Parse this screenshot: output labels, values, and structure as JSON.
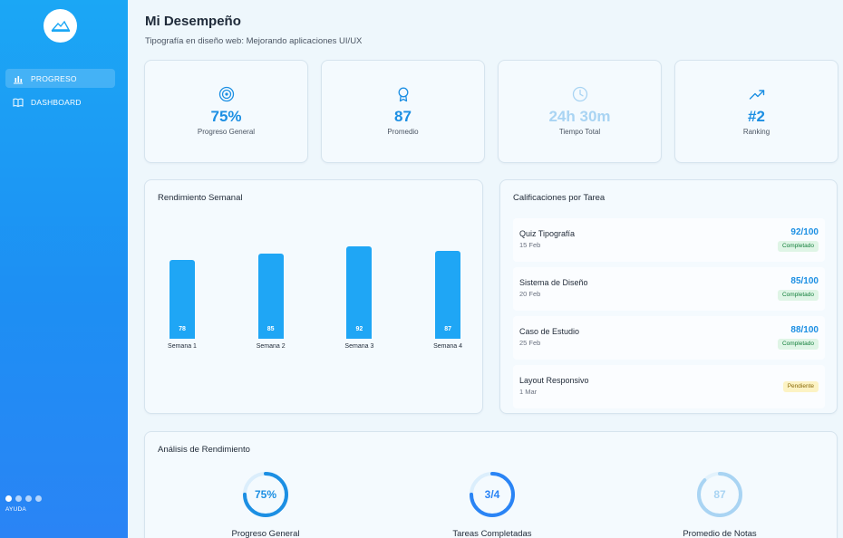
{
  "header": {
    "title": "Mi Desempeño",
    "subtitle": "Tipografía en diseño web: Mejorando aplicaciones UI/UX"
  },
  "sidebar": {
    "items": [
      {
        "label": "PROGRESO",
        "icon": "bar-chart-icon",
        "active": true
      },
      {
        "label": "DASHBOARD",
        "icon": "book-icon",
        "active": false
      }
    ],
    "help_label": "AYUDA"
  },
  "stats": [
    {
      "icon": "target-icon",
      "value": "75%",
      "label": "Progreso General"
    },
    {
      "icon": "award-icon",
      "value": "87",
      "label": "Promedio"
    },
    {
      "icon": "clock-icon",
      "value": "24h 30m",
      "label": "Tiempo Total"
    },
    {
      "icon": "trending-up-icon",
      "value": "#2",
      "label": "Ranking"
    }
  ],
  "weekly": {
    "title": "Rendimiento Semanal"
  },
  "chart_data": {
    "type": "bar",
    "categories": [
      "Semana 1",
      "Semana 2",
      "Semana 3",
      "Semana 4"
    ],
    "values": [
      78,
      85,
      92,
      87
    ]
  },
  "grades": {
    "title": "Calificaciones por Tarea",
    "items": [
      {
        "name": "Quiz Tipografía",
        "date": "15 Feb",
        "score": "92/100",
        "status": "Completado"
      },
      {
        "name": "Sistema de Diseño",
        "date": "20 Feb",
        "score": "85/100",
        "status": "Completado"
      },
      {
        "name": "Caso de Estudio",
        "date": "25 Feb",
        "score": "88/100",
        "status": "Completado"
      },
      {
        "name": "Layout Responsivo",
        "date": "1 Mar",
        "score": "",
        "status": "Pendiente"
      }
    ]
  },
  "analysis": {
    "title": "Análisis de Rendimiento",
    "rings": [
      {
        "value": "75%",
        "label": "Progreso General",
        "fraction": 0.75,
        "color": "#1c8fe3"
      },
      {
        "value": "3/4",
        "label": "Tareas Completadas",
        "fraction": 0.75,
        "color": "#2a84f5"
      },
      {
        "value": "87",
        "label": "Promedio de Notas",
        "fraction": 0.87,
        "color": "#a9d4f3"
      }
    ]
  },
  "colors": {
    "accent": "#1c8fe3",
    "bar": "#1fa6f5",
    "sidebar_top": "#1ba7f5",
    "sidebar_bottom": "#2a84f5",
    "completed_badge": "#dff5e6",
    "pending_badge": "#fcf3c4"
  }
}
